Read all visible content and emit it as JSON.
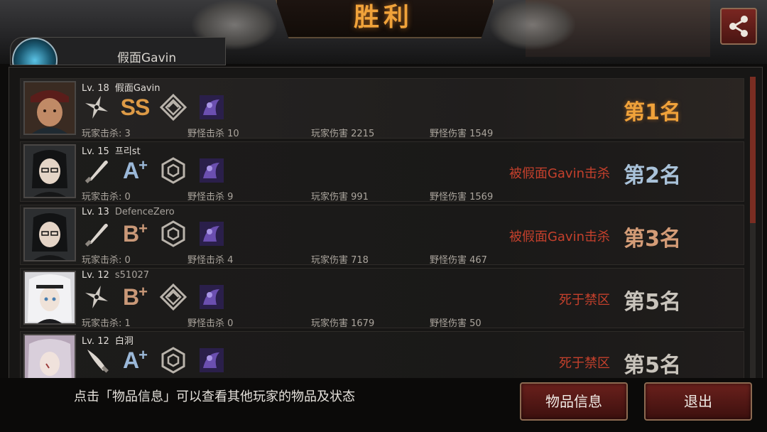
{
  "header": {
    "title": "胜利",
    "player_tag_name": "假面Gavin"
  },
  "players": [
    {
      "level": "Lv. 18",
      "name": "假面Gavin",
      "grade": "SS",
      "grade_plus": "",
      "weapon_icon": "shuriken-icon",
      "stats": {
        "player_kills": "玩家击杀: 3",
        "monster_kills": "野怪击杀 10",
        "player_damage": "玩家伤害 2215",
        "monster_damage": "野怪伤害 1549"
      },
      "cause": "",
      "rank": "第1名"
    },
    {
      "level": "Lv. 15",
      "name": "프리st",
      "grade": "A",
      "grade_plus": "+",
      "weapon_icon": "bat-icon",
      "stats": {
        "player_kills": "玩家击杀: 0",
        "monster_kills": "野怪击杀 9",
        "player_damage": "玩家伤害 991",
        "monster_damage": "野怪伤害 1569"
      },
      "cause": "被假面Gavin击杀",
      "rank": "第2名"
    },
    {
      "level": "Lv. 13",
      "name": "DefenceZero",
      "grade": "B",
      "grade_plus": "+",
      "weapon_icon": "bat-icon",
      "stats": {
        "player_kills": "玩家击杀: 0",
        "monster_kills": "野怪击杀 4",
        "player_damage": "玩家伤害 718",
        "monster_damage": "野怪伤害 467"
      },
      "cause": "被假面Gavin击杀",
      "rank": "第3名"
    },
    {
      "level": "Lv. 12",
      "name": "s51027",
      "grade": "B",
      "grade_plus": "+",
      "weapon_icon": "shuriken-icon",
      "stats": {
        "player_kills": "玩家击杀: 1",
        "monster_kills": "野怪击杀 0",
        "player_damage": "玩家伤害 1679",
        "monster_damage": "野怪伤害 50"
      },
      "cause": "死于禁区",
      "rank": "第5名"
    },
    {
      "level": "Lv. 12",
      "name": "白洞",
      "grade": "A",
      "grade_plus": "+",
      "weapon_icon": "knife-icon",
      "stats": {
        "player_kills": "",
        "monster_kills": "",
        "player_damage": "",
        "monster_damage": ""
      },
      "cause": "死于禁区",
      "rank": "第5名"
    }
  ],
  "footer": {
    "hint": "点击「物品信息」可以查看其他玩家的物品及状态",
    "items_button": "物品信息",
    "exit_button": "退出"
  },
  "colors": {
    "title": "#f0a23a",
    "cause": "#c4402c",
    "button_bg": "#6a201c"
  }
}
